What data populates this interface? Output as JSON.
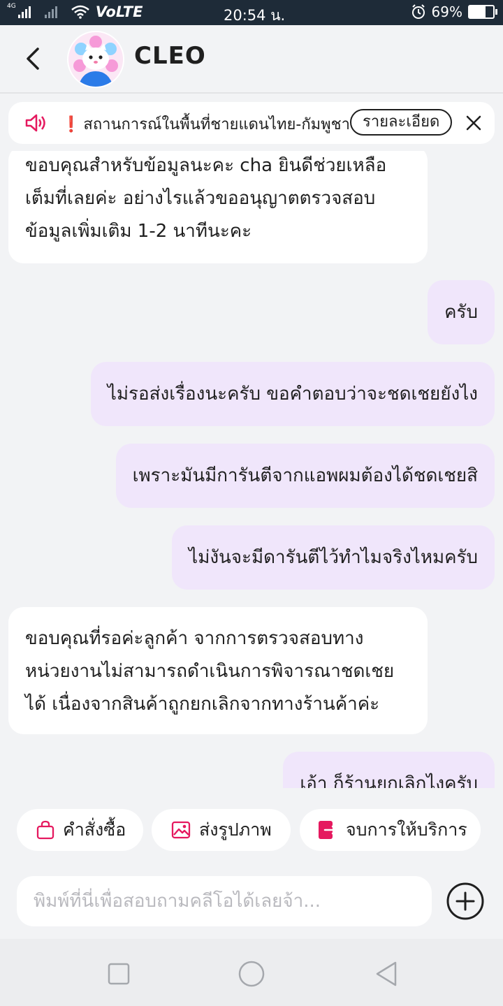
{
  "status_bar": {
    "network": "4G",
    "carrier_label": "VoLTE",
    "time": "20:54 น.",
    "battery_percent": "69%",
    "battery_level": 0.69
  },
  "header": {
    "title": "CLEO"
  },
  "announcement": {
    "mark": "❗",
    "text": "สถานการณ์ในพื้นที่ชายแดนไทย-กัมพูชา",
    "detail_label": "รายละเอียด"
  },
  "messages": [
    {
      "side": "in",
      "lines": [
        "ขอบคุณสำหรับข้อมูลนะคะ  cha ยินดีช่วยเหลือ",
        "เต็มที่เลยค่ะ อย่างไรแล้วขออนุญาตตรวจสอบ",
        "ข้อมูลเพิ่มเติม 1-2 นาทีนะคะ"
      ]
    },
    {
      "side": "out",
      "text": "ครับ"
    },
    {
      "side": "out",
      "text": "ไม่รอส่งเรื่องนะครับ ขอคำตอบว่าจะชดเชยยังไง"
    },
    {
      "side": "out",
      "text": "เพราะมันมีการันตีจากแอพผมต้องได้ชดเชยสิ"
    },
    {
      "side": "out",
      "text": "ไม่งันจะมีดารันตีไว้ทำไมจริงไหมครับ"
    },
    {
      "side": "in",
      "lines": [
        "ขอบคุณที่รอค่ะลูกค้า จากการตรวจสอบทาง",
        "หน่วยงานไม่สามารถดำเนินการพิจารณาชดเชย",
        "ได้ เนื่องจากสินค้าถูกยกเลิกจากทางร้านค้าค่ะ"
      ]
    },
    {
      "side": "out",
      "text": "เอ้า ก็ร้านยกเลิกไงครับ"
    }
  ],
  "quick_actions": [
    {
      "label": "คำสั่งซื้อ",
      "icon": "shopping-bag-icon"
    },
    {
      "label": "ส่งรูปภาพ",
      "icon": "image-icon"
    },
    {
      "label": "จบการให้บริการ",
      "icon": "exit-icon"
    }
  ],
  "composer": {
    "placeholder": "พิมพ์ที่นี่เพื่อสอบถามคลีโอได้เลยจ้า..."
  },
  "colors": {
    "accent": "#e5195f",
    "out_bubble": "#f0e6fb",
    "in_bubble": "#ffffff",
    "status_bar": "#1e2b38"
  }
}
